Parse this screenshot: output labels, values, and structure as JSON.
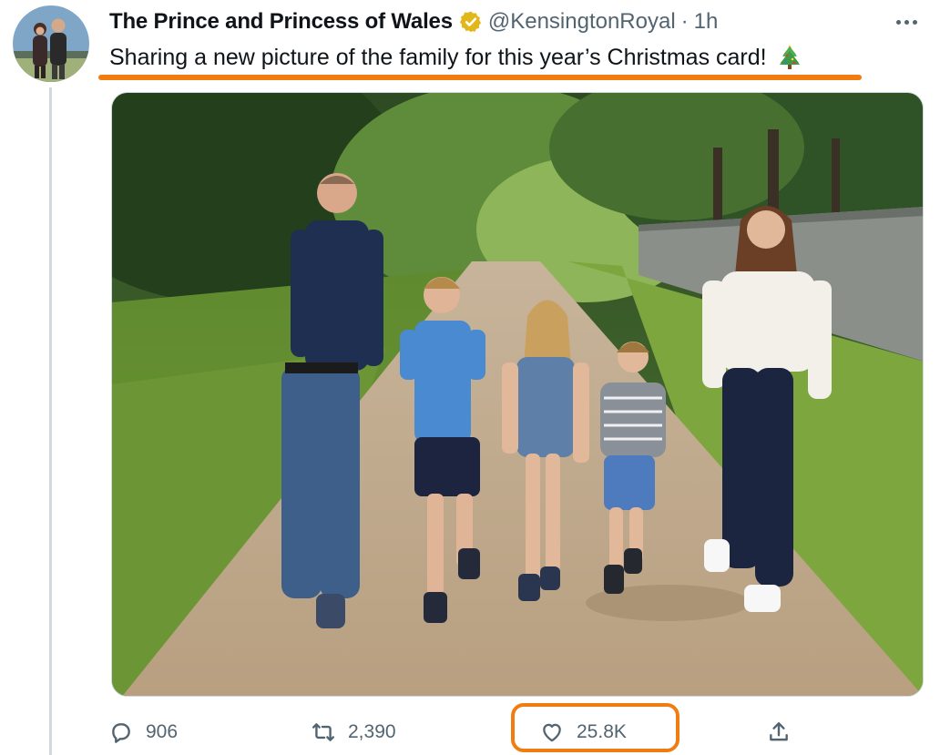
{
  "tweet": {
    "display_name": "The Prince and Princess of Wales",
    "handle": "@KensingtonRoyal",
    "separator": "·",
    "time": "1h",
    "text": "Sharing a new picture of the family for this year’s Christmas card!",
    "avatar_icon": "family-photo-avatar",
    "verified_icon": "verified-gold-badge",
    "more_icon": "more-horizontal-icon",
    "emoji_icon": "christmas-tree-icon"
  },
  "actions": {
    "reply": {
      "icon": "reply-icon",
      "count": "906"
    },
    "retweet": {
      "icon": "retweet-icon",
      "count": "2,390"
    },
    "like": {
      "icon": "heart-icon",
      "count": "25.8K"
    },
    "share": {
      "icon": "share-icon"
    }
  },
  "colors": {
    "highlight": "#f07d12",
    "verified": "#e2b719",
    "muted_text": "#536471",
    "primary_text": "#0f1419"
  }
}
